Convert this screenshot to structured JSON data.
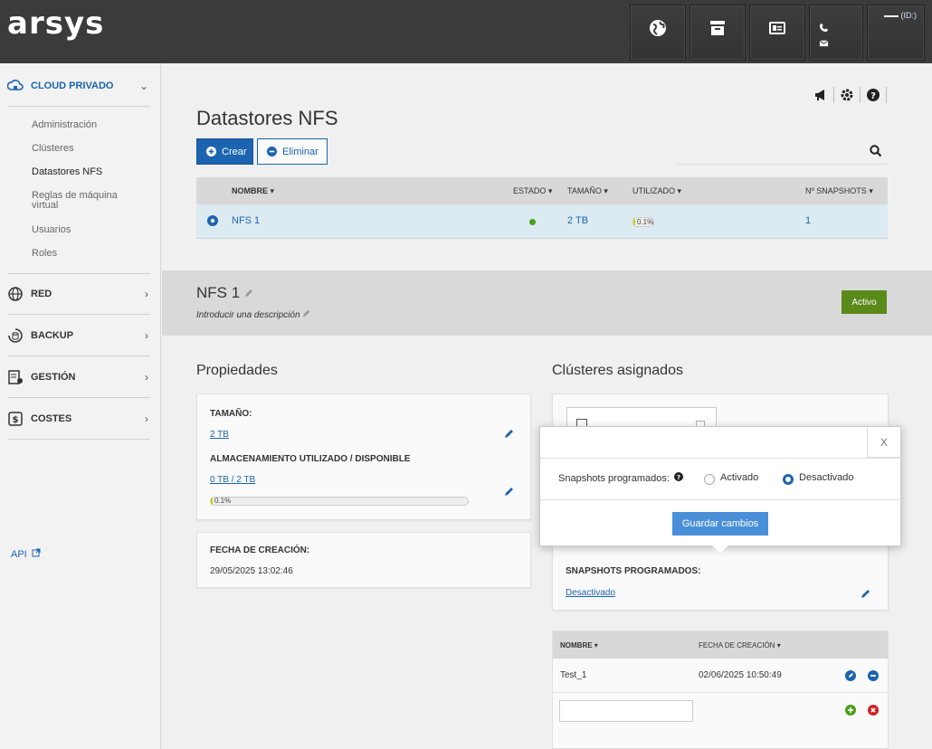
{
  "header": {
    "logo": "arsys",
    "user_badge": "(ID:)",
    "icons": [
      "globe-icon",
      "store-icon",
      "id-card-icon",
      "phone-icon",
      "mail-icon"
    ]
  },
  "sidebar": {
    "sections": [
      {
        "label": "CLOUD PRIVADO",
        "icon": "cloud-lock-icon"
      },
      {
        "label": "RED",
        "icon": "globe-icon"
      },
      {
        "label": "BACKUP",
        "icon": "backup-icon"
      },
      {
        "label": "GESTIÓN",
        "icon": "management-icon"
      },
      {
        "label": "COSTES",
        "icon": "billing-icon"
      }
    ],
    "subitems": [
      "Administración",
      "Clústeres",
      "Datastores NFS",
      "Reglas de máquina virtual",
      "Usuarios",
      "Roles"
    ],
    "api_link": "API"
  },
  "page": {
    "title": "Datastores NFS",
    "crear_label": "Crear",
    "eliminar_label": "Eliminar",
    "search_placeholder": ""
  },
  "table": {
    "columns": [
      "NOMBRE",
      "ESTADO",
      "TAMAÑO",
      "UTILIZADO",
      "Nº SNAPSHOTS"
    ],
    "rows": [
      {
        "name": "NFS 1",
        "size": "2 TB",
        "used": "0.1%",
        "used_fraction": 0.001,
        "snapshots": "1"
      }
    ]
  },
  "detail": {
    "name": "NFS 1",
    "description_placeholder": "Introducir una descripción",
    "status": "Activo",
    "status_color": "#5a8a1a"
  },
  "properties": {
    "title": "Propiedades",
    "size_label": "TAMAÑO:",
    "size_value": "2 TB",
    "storage_label": "ALMACENAMIENTO UTILIZADO / DISPONIBLE",
    "storage_value": "0 TB / 2 TB",
    "storage_pct": "0.1%",
    "created_label": "FECHA DE CREACIÓN:",
    "created_value": "29/05/2025 13:02:46"
  },
  "clusters": {
    "title": "Clústeres asignados",
    "snap_label": "SNAPSHOTS PROGRAMADOS:",
    "snap_value": "Desactivado"
  },
  "snapshots": {
    "col_name": "NOMBRE",
    "col_date": "FECHA DE CREACIÓN",
    "rows": [
      {
        "name": "Test_1",
        "date": "02/06/2025 10:50:49"
      }
    ]
  },
  "modal": {
    "close": "X",
    "question": "Snapshots programados:",
    "opt_on": "Activado",
    "opt_off": "Desactivado",
    "selected": "Desactivado",
    "save": "Guardar cambios"
  },
  "colors": {
    "brand_blue": "#1c64b0",
    "header_bg": "#3b3b3b",
    "active_green": "#5a8a1a"
  }
}
